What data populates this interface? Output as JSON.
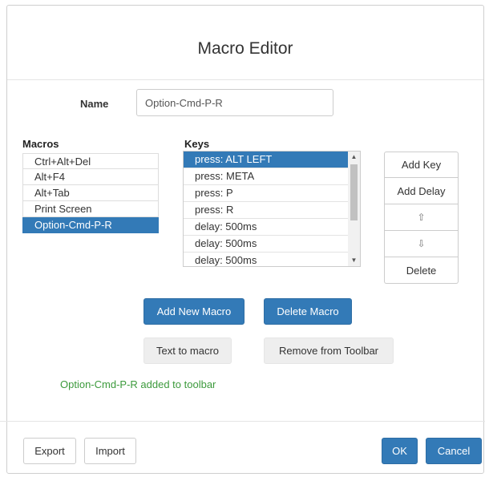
{
  "dialog": {
    "title": "Macro Editor"
  },
  "name": {
    "label": "Name",
    "value": "Option-Cmd-P-R"
  },
  "macros": {
    "heading": "Macros",
    "items": [
      "Ctrl+Alt+Del",
      "Alt+F4",
      "Alt+Tab",
      "Print Screen",
      "Option-Cmd-P-R"
    ],
    "selected": "Option-Cmd-P-R"
  },
  "keys": {
    "heading": "Keys",
    "items": [
      "press: ALT LEFT",
      "press: META",
      "press: P",
      "press: R",
      "delay: 500ms",
      "delay: 500ms",
      "delay: 500ms"
    ],
    "selected": "press: ALT LEFT"
  },
  "key_actions": {
    "add_key": "Add Key",
    "add_delay": "Add Delay",
    "move_up": "⇧",
    "move_down": "⇩",
    "delete": "Delete"
  },
  "actions": {
    "add_new_macro": "Add New Macro",
    "delete_macro": "Delete Macro",
    "text_to_macro": "Text to macro",
    "remove_from_toolbar": "Remove from Toolbar"
  },
  "status_message": "Option-Cmd-P-R added to toolbar",
  "footer": {
    "export": "Export",
    "import": "Import",
    "ok": "OK",
    "cancel": "Cancel"
  },
  "colors": {
    "primary": "#337ab7",
    "status_text": "#3c9a3c",
    "light_button": "#eeeeee"
  }
}
